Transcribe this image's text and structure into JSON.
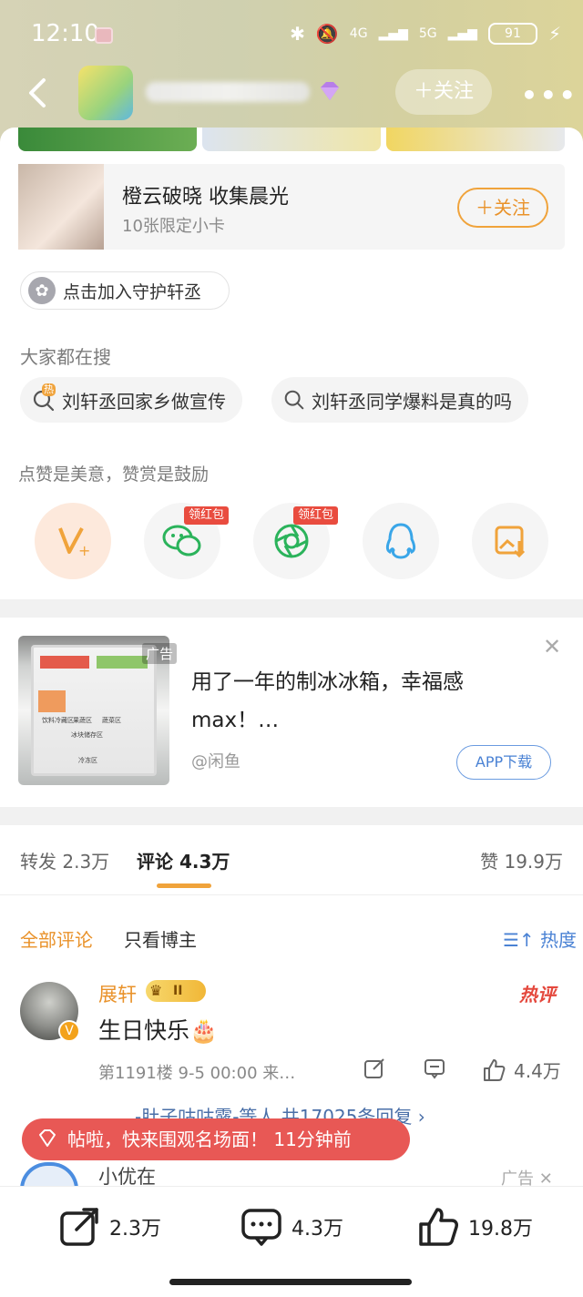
{
  "status_bar": {
    "time": "12:10",
    "battery": "91",
    "network_1": "4G",
    "network_2": "5G"
  },
  "header": {
    "follow_label": "＋关注"
  },
  "card": {
    "title": "橙云破晓 收集晨光",
    "subtitle": "10张限定小卡",
    "follow_label": "＋关注"
  },
  "guard": {
    "label": "点击加入守护轩丞"
  },
  "search": {
    "title": "大家都在搜",
    "items": [
      {
        "label": "刘轩丞回家乡做宣传",
        "hot_badge": "热"
      },
      {
        "label": "刘轩丞同学爆料是真的吗"
      }
    ]
  },
  "praise": {
    "note": "点赞是美意，赞赏是鼓励",
    "red_packet_tag": "领红包",
    "actions": [
      {
        "name": "reward",
        "icon": "reward-v-icon"
      },
      {
        "name": "wechat",
        "icon": "wechat-icon"
      },
      {
        "name": "moments",
        "icon": "moments-icon"
      },
      {
        "name": "qq",
        "icon": "qq-icon"
      },
      {
        "name": "save-image",
        "icon": "save-image-icon"
      }
    ]
  },
  "ad": {
    "label": "广告",
    "title": "用了一年的制冰冰箱，幸福感max！…",
    "source": "@闲鱼",
    "button": "APP下载",
    "image_labels": [
      "饮料冷藏区",
      "冰块储存区",
      "果蔬区",
      "蔬菜区",
      "冷冻区"
    ]
  },
  "tabs": {
    "repost": "转发 2.3万",
    "comment": "评论 4.3万",
    "like": "赞 19.9万"
  },
  "comment_filter": {
    "all": "全部评论",
    "author_only": "只看博主",
    "sort": "热度"
  },
  "comment": {
    "user": "展轩",
    "level": "II",
    "hot_tag": "热评",
    "text": "生日快乐🎂",
    "meta": "第1191楼  9-5 00:00  来…",
    "likes": "4.4万",
    "replies": "……-肚子咕咕露-等人 共17025条回复 ›"
  },
  "toast": {
    "text": "帖啦，快来围观名场面！ 11分钟前"
  },
  "next_comment": {
    "user": "小优在_",
    "ad_label": "广告"
  },
  "bottom_bar": {
    "repost": "2.3万",
    "comment": "4.3万",
    "like": "19.8万"
  },
  "colors": {
    "accent": "#f0a33b",
    "link": "#4a82d4",
    "toast": "#e85855",
    "hot": "#e4483d"
  }
}
